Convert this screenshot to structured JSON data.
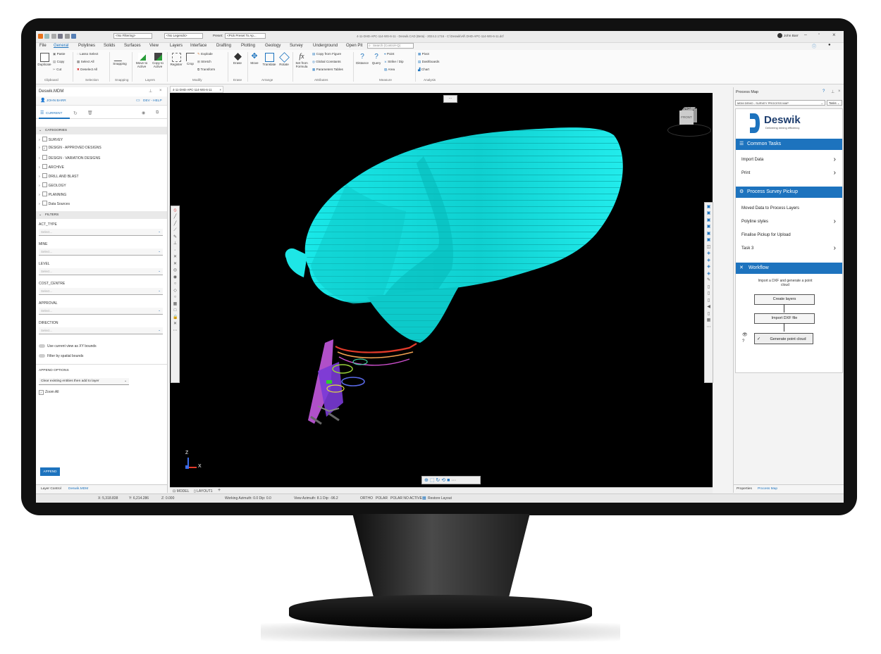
{
  "window": {
    "title": "4-11-DHD-APC-114-WS-6-11 - Deswik.CAD (Beta) - 2024.2.1716 - C:\\Deswik\\All\\ DHD-APC-114-WS-6-11.dcf",
    "user": "John Barr",
    "layer_filter": "<No Filtering>",
    "legend": "<No Legends>",
    "preset_label": "Preset:",
    "preset_value": "<Pick Preset To Ap..."
  },
  "menu": [
    "File",
    "General",
    "Polylines",
    "Solids",
    "Surfaces",
    "View",
    "Layers",
    "Interface",
    "Drafting",
    "Plotting",
    "Geology",
    "Survey",
    "Underground",
    "Open Pit"
  ],
  "search_placeholder": "Search (Control+Q)",
  "ribbon": {
    "clipboard": {
      "duplicate": "Duplicate",
      "paste": "Paste",
      "copy": "Copy",
      "cut": "Cut",
      "group": "Clipboard"
    },
    "selection": {
      "lasso": "Lasso Select",
      "select_all": "Select All",
      "deselect_all": "Deselect All",
      "group": "Selection"
    },
    "snapping": {
      "snapping": "Snapping",
      "group": "Snapping"
    },
    "layers": {
      "move_active": "Move to Active",
      "copy_active": "Copy to Active",
      "group": "Layers"
    },
    "modify": {
      "register": "Register",
      "crop": "Crop",
      "explode": "Explode",
      "stretch": "Stretch",
      "transform": "Transform",
      "group": "Modify"
    },
    "erase": {
      "erase": "Erase",
      "group": "Erase"
    },
    "arrange": {
      "move": "Move",
      "translate": "Translate",
      "rotate": "Rotate",
      "group": "Arrange"
    },
    "attributes": {
      "set_from_formula": "Set from Formula",
      "copy_from_figure": "Copy from Figure",
      "global_constants": "Global Constants",
      "parameters_tables": "Parameters Tables",
      "group": "Attributes"
    },
    "measure": {
      "distance": "Distance",
      "query": "Query",
      "point": "Point",
      "strike_dip": "Strike / Dip",
      "area": "Area",
      "group": "Measure"
    },
    "analysis": {
      "pivot": "Pivot",
      "dashboards": "Dashboards",
      "chart": "Chart",
      "group": "Analysis"
    }
  },
  "left_panel": {
    "title": "Deswik.MDM",
    "user": "JOHN BARR",
    "env": "DEV - HELP",
    "tab_current": "CURRENT",
    "categories_header": "CATEGORIES",
    "categories": [
      {
        "label": "SURVEY",
        "checked": false
      },
      {
        "label": "DESIGN - APPROVED DESIGNS",
        "checked": true
      },
      {
        "label": "DESIGN - VARIATION DESIGNS",
        "checked": false
      },
      {
        "label": "ARCHIVE",
        "checked": false
      },
      {
        "label": "DRILL AND BLAST",
        "checked": false
      },
      {
        "label": "GEOLOGY",
        "checked": false
      },
      {
        "label": "PLANNING",
        "checked": false
      },
      {
        "label": "Data Sources",
        "checked": false
      }
    ],
    "filters_header": "FILTERS",
    "filters": [
      "ACT_TYPE",
      "MINE",
      "LEVEL",
      "COST_CENTRE",
      "APPROVAL",
      "DIRECTION"
    ],
    "select_placeholder": "Select...",
    "use_view_bounds": "Use current view as XY bounds",
    "filter_spatial": "Filter by spatial bounds",
    "append_options_header": "APPEND OPTIONS",
    "append_mode": "Clear existing entities then add to layer",
    "zoom_all": "Zoom All",
    "append_button": "APPEND",
    "bottom_tabs": [
      "Layer Control",
      "Deswik.MDM"
    ]
  },
  "viewport": {
    "doc_tab": "4-11-DHD-APC-114-WS-6-11",
    "cube_top": "TOP",
    "cube_face": "FRONT",
    "axis_z": "Z",
    "axis_x": "X",
    "model_tab": "MODEL",
    "layout_tab": "LAYOUT1"
  },
  "right_panel": {
    "title": "Process Map",
    "dropdown": "MDM DEMO - SURVEY PROCESS MAP",
    "tasks_btn": "Tasks",
    "logo_name": "Deswik",
    "logo_tagline": "Delivering mining efficiency",
    "common_tasks": "Common Tasks",
    "common_items": [
      "Import Data",
      "Print"
    ],
    "survey_header": "Process Survey Pickup",
    "survey_items": [
      "Moved Data to Process Layers",
      "Polyline styles",
      "Finalise Pickup for Upload",
      "Task 3"
    ],
    "workflow_header": "Workflow",
    "workflow_desc": "Import a DXF and generate a point cloud",
    "workflow_steps": [
      "Create layers",
      "Import DXF file",
      "Generate point cloud"
    ],
    "bottom_tabs": [
      "Properties",
      "Process Map"
    ]
  },
  "statusbar": {
    "x": "X: 5,318.838",
    "y": "Y: 6,214.286",
    "z": "Z: 0.000",
    "azimuth": "Working Azimuth: 0.0 Dip: 0.0",
    "view": "View Azimuth: 8.1 Dip: -96.2",
    "ortho": "ORTHO",
    "polar": "POLAR",
    "polar_snap": "POLAR NO ACTIVE",
    "layout": "Restore Layout"
  },
  "colors": {
    "pit": "#00e6e6",
    "accent": "#1d73be"
  }
}
